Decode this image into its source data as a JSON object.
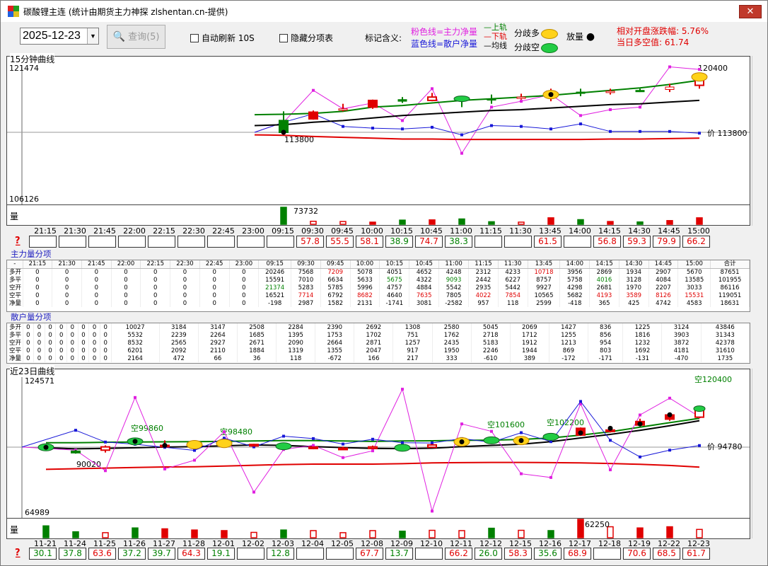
{
  "window": {
    "title": "碳酸锂主连 (统计由期货主力神探 zlshentan.cn-提供)",
    "close": "✕"
  },
  "toolbar": {
    "date": "2025-12-23",
    "query_label": "查询(5)",
    "auto_refresh_label": "自动刷新 10S",
    "hide_table_label": "隐藏分项表",
    "legend_label": "标记含义:",
    "pink_line": "粉色线=主力净量",
    "blue_line": "蓝色线=散户净量",
    "upper_band": "上轨",
    "lower_band": "下轨",
    "mid_band": "均线",
    "div_long": "分歧多",
    "div_short": "分歧空",
    "volume_label": "放量",
    "range_label": "相对开盘涨跌幅: 5.76%",
    "net_short_label": "当日多空值: 61.74",
    "colors": {
      "pink": "#e020e0",
      "blue": "#1818d8",
      "green": "#008000",
      "red": "#e00000",
      "black": "#000000",
      "yellow": "#ffd21a",
      "greenEll": "#22cc44"
    }
  },
  "top": {
    "title": "15分钟曲线",
    "ymax_label": "121474",
    "ymin_label": "106126",
    "price_label": "价 113800",
    "last_label": "120400",
    "low_label": "113800",
    "vol_title": "量",
    "vol_max_label": "73732",
    "times": [
      "21:15",
      "21:30",
      "21:45",
      "22:00",
      "22:15",
      "22:30",
      "22:45",
      "23:00",
      "09:15",
      "09:30",
      "09:45",
      "10:00",
      "10:15",
      "10:45",
      "11:00",
      "11:15",
      "11:30",
      "13:45",
      "14:00",
      "14:15",
      "14:30",
      "14:45",
      "15:00"
    ],
    "scores": [
      "",
      "",
      "",
      "",
      "",
      "",
      "",
      "",
      "",
      "57.8",
      "55.5",
      "58.1",
      "38.9",
      "74.7",
      "38.3",
      "",
      "",
      "61.5",
      "",
      "56.8",
      "59.3",
      "79.9",
      "66.2"
    ]
  },
  "chart_data": [
    {
      "type": "candlestick",
      "title": "15分钟曲线",
      "x": [
        "09:15",
        "09:30",
        "09:45",
        "10:00",
        "10:15",
        "10:45",
        "11:00",
        "11:15",
        "11:30",
        "13:45",
        "14:00",
        "14:15",
        "14:30",
        "14:45",
        "15:00"
      ],
      "ylim": [
        106126,
        121474
      ],
      "candles": [
        {
          "o": 115200,
          "c": 113800,
          "h": 116300,
          "l": 113500,
          "color": "green"
        },
        {
          "o": 115400,
          "c": 116200,
          "h": 116400,
          "l": 115300,
          "color": "red"
        },
        {
          "o": 116600,
          "c": 116600,
          "h": 117200,
          "l": 116300,
          "color": "red"
        },
        {
          "o": 116800,
          "c": 117600,
          "h": 117700,
          "l": 116600,
          "color": "red"
        },
        {
          "o": 117700,
          "c": 117500,
          "h": 118000,
          "l": 117300,
          "color": "green"
        },
        {
          "o": 117600,
          "c": 118000,
          "h": 118500,
          "l": 117500,
          "color": "red"
        },
        {
          "o": 117800,
          "c": 117800,
          "h": 118000,
          "l": 116800,
          "color": "green"
        },
        {
          "o": 117800,
          "c": 117800,
          "h": 118300,
          "l": 117200,
          "color": "green"
        },
        {
          "o": 118000,
          "c": 118000,
          "h": 118400,
          "l": 117700,
          "color": "red"
        },
        {
          "o": 118100,
          "c": 118300,
          "h": 119000,
          "l": 117500,
          "color": "red"
        },
        {
          "o": 118600,
          "c": 118600,
          "h": 119000,
          "l": 118100,
          "color": "green"
        },
        {
          "o": 118700,
          "c": 118700,
          "h": 119000,
          "l": 118300,
          "color": "red"
        },
        {
          "o": 118800,
          "c": 118800,
          "h": 119000,
          "l": 118600,
          "color": "green"
        },
        {
          "o": 118900,
          "c": 119200,
          "h": 119600,
          "l": 118600,
          "color": "red"
        },
        {
          "o": 119400,
          "c": 120400,
          "h": 120500,
          "l": 119000,
          "color": "red"
        }
      ],
      "series": [
        {
          "name": "粉色线=主力净量",
          "values": [
            113800,
            115000,
            118800,
            116600,
            117300,
            115200,
            119000,
            111300,
            116800,
            117500,
            118300,
            115800,
            116500,
            116800,
            121600,
            121300
          ]
        },
        {
          "name": "蓝色线=散户净量",
          "values": [
            113800,
            115000,
            116000,
            114500,
            114300,
            114200,
            114400,
            113500,
            114600,
            114500,
            114200,
            114800,
            113900,
            113900,
            113900,
            113700
          ]
        },
        {
          "name": "上轨",
          "values": [
            115900,
            115950,
            116050,
            116300,
            116800,
            117000,
            117300,
            117600,
            117800,
            118000,
            118200,
            118500,
            118800,
            119100,
            119500,
            120000
          ]
        },
        {
          "name": "均线",
          "values": [
            114600,
            114700,
            115000,
            115200,
            115500,
            115800,
            116000,
            116200,
            116400,
            116500,
            116700,
            116900,
            117100,
            117200,
            117400,
            117600
          ]
        },
        {
          "name": "下轨",
          "values": [
            113500,
            113450,
            113300,
            113200,
            113100,
            113000,
            113000,
            112950,
            112950,
            112950,
            112950,
            112950,
            113000,
            113000,
            113050,
            113100
          ]
        }
      ],
      "volume": [
        73732,
        13000,
        12000,
        8000,
        18000,
        19000,
        23000,
        11000,
        8000,
        28000,
        20000,
        12000,
        10000,
        16000,
        28000
      ]
    },
    {
      "type": "candlestick",
      "title": "近23日曲线",
      "x": [
        "11-21",
        "11-24",
        "11-25",
        "11-26",
        "11-27",
        "11-28",
        "12-01",
        "12-02",
        "12-03",
        "12-04",
        "12-05",
        "12-08",
        "12-09",
        "12-10",
        "12-11",
        "12-12",
        "12-15",
        "12-16",
        "12-17",
        "12-18",
        "12-19",
        "12-22",
        "12-23"
      ],
      "ylim": [
        64989,
        124571
      ],
      "labels": [
        "90020",
        "空99860",
        "空98480",
        "空101600",
        "空102200",
        "空120400",
        "价 94780"
      ],
      "series": [
        {
          "name": "上轨",
          "values": [
            96800,
            96800,
            97000,
            97100,
            97200,
            97300,
            97400,
            97600,
            97800,
            97800,
            97600,
            97400,
            97600,
            97700,
            97900,
            98000,
            98300,
            99000,
            100300,
            101800,
            103900,
            106000,
            108000
          ]
        },
        {
          "name": "均线",
          "values": [
            94500,
            94000,
            94200,
            94500,
            94800,
            95000,
            95400,
            95800,
            95600,
            95000,
            94600,
            94200,
            94100,
            94300,
            95000,
            95600,
            96100,
            97300,
            99000,
            100600,
            102500,
            104600,
            106900
          ]
        },
        {
          "name": "下轨",
          "values": [
            84600,
            84900,
            85200,
            85500,
            85700,
            85800,
            86100,
            86500,
            86800,
            87000,
            87000,
            87000,
            87200,
            87600,
            87700,
            87800,
            87800,
            87700,
            87600,
            87300,
            86900,
            86400,
            85600
          ]
        }
      ]
    }
  ],
  "main_table": {
    "title": "主力量分项",
    "headers": [
      "-",
      "21:15",
      "21:30",
      "21:45",
      "22:00",
      "22:15",
      "22:30",
      "22:45",
      "23:00",
      "09:15",
      "09:30",
      "09:45",
      "10:00",
      "10:15",
      "10:45",
      "11:00",
      "11:15",
      "11:30",
      "13:45",
      "14:00",
      "14:15",
      "14:30",
      "14:45",
      "15:00",
      "合计"
    ],
    "rows": [
      [
        "多开",
        "0",
        "0",
        "0",
        "0",
        "0",
        "0",
        "0",
        "0",
        "20246",
        "7568",
        "7209",
        "5078",
        "4051",
        "4652",
        "4248",
        "2312",
        "4233",
        "10718",
        "3956",
        "2869",
        "1934",
        "2907",
        "5670",
        "87651"
      ],
      [
        "多平",
        "0",
        "0",
        "0",
        "0",
        "0",
        "0",
        "0",
        "0",
        "15591",
        "7010",
        "6634",
        "5633",
        "5675",
        "4322",
        "9093",
        "2442",
        "6227",
        "8757",
        "5758",
        "4016",
        "3128",
        "4084",
        "13585",
        "101955"
      ],
      [
        "空开",
        "0",
        "0",
        "0",
        "0",
        "0",
        "0",
        "0",
        "0",
        "21374",
        "5283",
        "5785",
        "5996",
        "4757",
        "4884",
        "5542",
        "2935",
        "5442",
        "9927",
        "4298",
        "2681",
        "1970",
        "2207",
        "3033",
        "86116"
      ],
      [
        "空平",
        "0",
        "0",
        "0",
        "0",
        "0",
        "0",
        "0",
        "0",
        "16521",
        "7714",
        "6792",
        "8682",
        "4640",
        "7635",
        "7805",
        "4022",
        "7854",
        "10565",
        "5682",
        "4193",
        "3589",
        "8126",
        "15531",
        "119051"
      ],
      [
        "净量",
        "0",
        "0",
        "0",
        "0",
        "0",
        "0",
        "0",
        "0",
        "-198",
        "2987",
        "1582",
        "2131",
        "-1741",
        "3081",
        "-2582",
        "957",
        "118",
        "2599",
        "-418",
        "365",
        "425",
        "4742",
        "4583",
        "18631"
      ]
    ],
    "red": [
      [
        0,
        11
      ],
      [
        0,
        18
      ],
      [
        3,
        10
      ],
      [
        3,
        12
      ],
      [
        3,
        14
      ],
      [
        3,
        16
      ],
      [
        3,
        17
      ],
      [
        3,
        20
      ],
      [
        3,
        21
      ],
      [
        3,
        22
      ],
      [
        3,
        23
      ]
    ],
    "green": [
      [
        1,
        13
      ],
      [
        1,
        15
      ],
      [
        1,
        20
      ],
      [
        2,
        9
      ]
    ]
  },
  "retail_table": {
    "title": "散户量分项",
    "rows": [
      [
        "多开",
        "0",
        "0",
        "0",
        "0",
        "0",
        "0",
        "0",
        "0",
        "10027",
        "3184",
        "3147",
        "2508",
        "2284",
        "2390",
        "2692",
        "1308",
        "2580",
        "5045",
        "2069",
        "1427",
        "836",
        "1225",
        "3124",
        "43846"
      ],
      [
        "多平",
        "0",
        "0",
        "0",
        "0",
        "0",
        "0",
        "0",
        "0",
        "5532",
        "2239",
        "2264",
        "1685",
        "1395",
        "1753",
        "1702",
        "751",
        "1762",
        "2718",
        "1712",
        "1255",
        "856",
        "1816",
        "3903",
        "31343"
      ],
      [
        "空开",
        "0",
        "0",
        "0",
        "0",
        "0",
        "0",
        "0",
        "0",
        "8532",
        "2565",
        "2927",
        "2671",
        "2090",
        "2664",
        "2871",
        "1257",
        "2435",
        "5183",
        "1912",
        "1213",
        "954",
        "1232",
        "3872",
        "42378"
      ],
      [
        "空平",
        "0",
        "0",
        "0",
        "0",
        "0",
        "0",
        "0",
        "0",
        "6201",
        "2092",
        "2110",
        "1884",
        "1319",
        "1355",
        "2047",
        "917",
        "1950",
        "2246",
        "1944",
        "869",
        "803",
        "1692",
        "4181",
        "31610"
      ],
      [
        "净量",
        "0",
        "0",
        "0",
        "0",
        "0",
        "0",
        "0",
        "0",
        "2164",
        "472",
        "66",
        "36",
        "118",
        "-672",
        "166",
        "217",
        "333",
        "-610",
        "389",
        "-172",
        "-171",
        "-131",
        "-470",
        "1735"
      ]
    ]
  },
  "bottom": {
    "title": "近23日曲线",
    "ymax_label": "124571",
    "ymin_label": "64989",
    "vol_title": "量",
    "vol_max_label": "62250",
    "dates": [
      "11-21",
      "11-24",
      "11-25",
      "11-26",
      "11-27",
      "11-28",
      "12-01",
      "12-02",
      "12-03",
      "12-04",
      "12-05",
      "12-08",
      "12-09",
      "12-10",
      "12-11",
      "12-12",
      "12-15",
      "12-16",
      "12-17",
      "12-18",
      "12-19",
      "12-22",
      "12-23"
    ],
    "scores": [
      "30.1",
      "37.8",
      "63.6",
      "37.2",
      "39.7",
      "64.3",
      "19.1",
      "",
      "12.8",
      "",
      "",
      "67.7",
      "13.7",
      "",
      "66.2",
      "26.0",
      "58.3",
      "35.6",
      "68.9",
      "",
      "70.6",
      "68.5",
      "61.7"
    ]
  }
}
